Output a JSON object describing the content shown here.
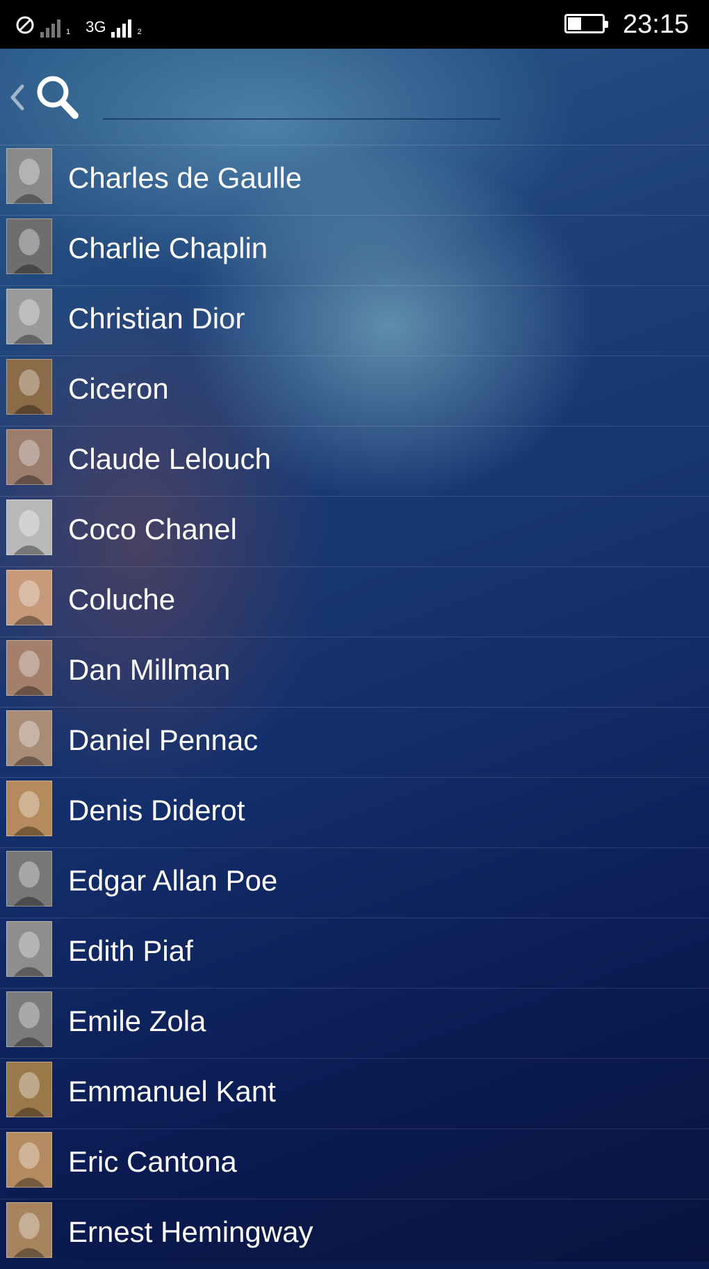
{
  "status_bar": {
    "sim1_label": "1",
    "network_label": "3G",
    "sim2_label": "2",
    "time": "23:15",
    "battery_level": 0.4
  },
  "search": {
    "value": "",
    "placeholder": ""
  },
  "people": [
    {
      "name": "Charles de Gaulle",
      "tone": "#8a8a8a"
    },
    {
      "name": "Charlie Chaplin",
      "tone": "#6e6e6e"
    },
    {
      "name": "Christian Dior",
      "tone": "#9a9a9a"
    },
    {
      "name": "Ciceron",
      "tone": "#8b6b48"
    },
    {
      "name": "Claude Lelouch",
      "tone": "#9c7c6a"
    },
    {
      "name": "Coco Chanel",
      "tone": "#b8b8b8"
    },
    {
      "name": "Coluche",
      "tone": "#c79a7a"
    },
    {
      "name": "Dan Millman",
      "tone": "#a47f6a"
    },
    {
      "name": "Daniel Pennac",
      "tone": "#a98c76"
    },
    {
      "name": "Denis Diderot",
      "tone": "#b58a5c"
    },
    {
      "name": "Edgar Allan Poe",
      "tone": "#777777"
    },
    {
      "name": "Edith Piaf",
      "tone": "#8e8e8e"
    },
    {
      "name": "Emile Zola",
      "tone": "#7c7c7c"
    },
    {
      "name": "Emmanuel Kant",
      "tone": "#9b7a4a"
    },
    {
      "name": "Eric Cantona",
      "tone": "#b48a60"
    },
    {
      "name": "Ernest Hemingway",
      "tone": "#a7845e"
    }
  ]
}
